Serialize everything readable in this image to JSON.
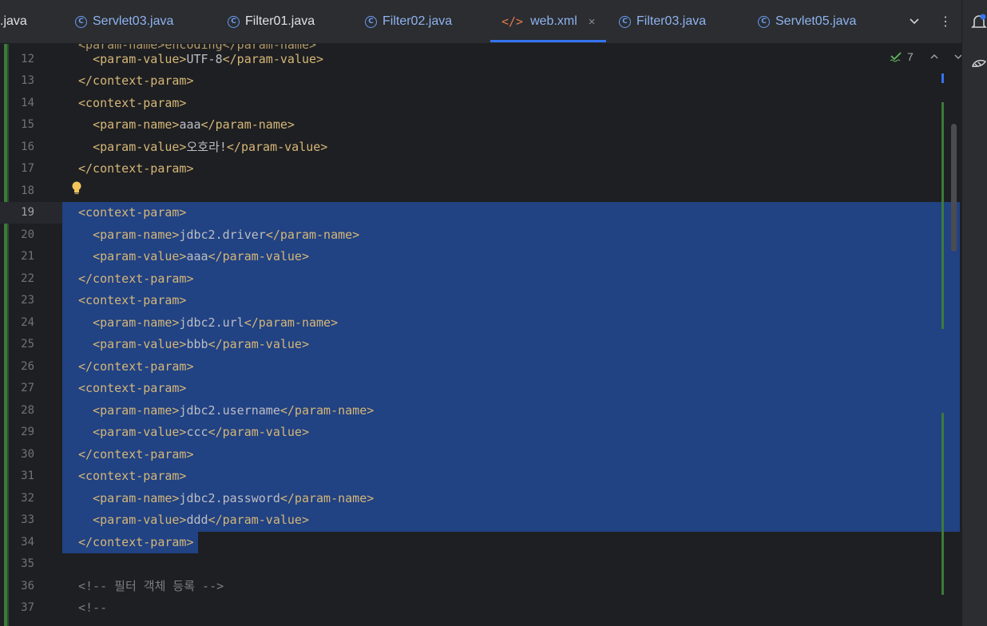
{
  "tabs": [
    {
      "label": ".java",
      "kind": "plain",
      "active": false
    },
    {
      "label": "Servlet03.java",
      "kind": "class",
      "active": false
    },
    {
      "label": "Filter01.java",
      "kind": "class",
      "active": false
    },
    {
      "label": "Filter02.java",
      "kind": "class",
      "active": false
    },
    {
      "label": "web.xml",
      "kind": "xml",
      "active": true
    },
    {
      "label": "Filter03.java",
      "kind": "class",
      "active": false
    },
    {
      "label": "Servlet05.java",
      "kind": "class",
      "active": false
    }
  ],
  "tab_icons": {
    "class": "C",
    "xml": "</>",
    "close": "×",
    "more_tabs": "⌄",
    "menu": "⋮"
  },
  "inspection": {
    "count": "7"
  },
  "current_line": 19,
  "top_fragment": "<param-name>encoding</param-name>",
  "lines": [
    {
      "n": "12",
      "parts": [
        {
          "t": "  "
        },
        {
          "c": "tg",
          "t": "<param-value>"
        },
        {
          "c": "tx",
          "t": "UTF-8"
        },
        {
          "c": "tg",
          "t": "</param-value>"
        }
      ]
    },
    {
      "n": "13",
      "parts": [
        {
          "c": "tg",
          "t": "</context-param>"
        }
      ]
    },
    {
      "n": "14",
      "parts": [
        {
          "c": "tg",
          "t": "<context-param>"
        }
      ]
    },
    {
      "n": "15",
      "parts": [
        {
          "t": "  "
        },
        {
          "c": "tg",
          "t": "<param-name>"
        },
        {
          "c": "tx",
          "t": "aaa"
        },
        {
          "c": "tg",
          "t": "</param-name>"
        }
      ]
    },
    {
      "n": "16",
      "parts": [
        {
          "t": "  "
        },
        {
          "c": "tg",
          "t": "<param-value>"
        },
        {
          "c": "tx",
          "t": "오호라!"
        },
        {
          "c": "tg",
          "t": "</param-value>"
        }
      ]
    },
    {
      "n": "17",
      "parts": [
        {
          "c": "tg",
          "t": "</context-param>"
        }
      ]
    },
    {
      "n": "18",
      "parts": []
    },
    {
      "n": "19",
      "parts": [
        {
          "c": "tg",
          "t": "<context-param>"
        }
      ]
    },
    {
      "n": "20",
      "parts": [
        {
          "t": "  "
        },
        {
          "c": "tg",
          "t": "<param-name>"
        },
        {
          "c": "tx",
          "t": "jdbc2.driver"
        },
        {
          "c": "tg",
          "t": "</param-name>"
        }
      ]
    },
    {
      "n": "21",
      "parts": [
        {
          "t": "  "
        },
        {
          "c": "tg",
          "t": "<param-value>"
        },
        {
          "c": "tx",
          "t": "aaa"
        },
        {
          "c": "tg",
          "t": "</param-value>"
        }
      ]
    },
    {
      "n": "22",
      "parts": [
        {
          "c": "tg",
          "t": "</context-param>"
        }
      ]
    },
    {
      "n": "23",
      "parts": [
        {
          "c": "tg",
          "t": "<context-param>"
        }
      ]
    },
    {
      "n": "24",
      "parts": [
        {
          "t": "  "
        },
        {
          "c": "tg",
          "t": "<param-name>"
        },
        {
          "c": "tx",
          "t": "jdbc2.url"
        },
        {
          "c": "tg",
          "t": "</param-name>"
        }
      ]
    },
    {
      "n": "25",
      "parts": [
        {
          "t": "  "
        },
        {
          "c": "tg",
          "t": "<param-value>"
        },
        {
          "c": "tx",
          "t": "bbb"
        },
        {
          "c": "tg",
          "t": "</param-value>"
        }
      ]
    },
    {
      "n": "26",
      "parts": [
        {
          "c": "tg",
          "t": "</context-param>"
        }
      ]
    },
    {
      "n": "27",
      "parts": [
        {
          "c": "tg",
          "t": "<context-param>"
        }
      ]
    },
    {
      "n": "28",
      "parts": [
        {
          "t": "  "
        },
        {
          "c": "tg",
          "t": "<param-name>"
        },
        {
          "c": "tx",
          "t": "jdbc2.username"
        },
        {
          "c": "tg",
          "t": "</param-name>"
        }
      ]
    },
    {
      "n": "29",
      "parts": [
        {
          "t": "  "
        },
        {
          "c": "tg",
          "t": "<param-value>"
        },
        {
          "c": "tx",
          "t": "ccc"
        },
        {
          "c": "tg",
          "t": "</param-value>"
        }
      ]
    },
    {
      "n": "30",
      "parts": [
        {
          "c": "tg",
          "t": "</context-param>"
        }
      ]
    },
    {
      "n": "31",
      "parts": [
        {
          "c": "tg",
          "t": "<context-param>"
        }
      ]
    },
    {
      "n": "32",
      "parts": [
        {
          "t": "  "
        },
        {
          "c": "tg",
          "t": "<param-name>"
        },
        {
          "c": "tx",
          "t": "jdbc2.password"
        },
        {
          "c": "tg",
          "t": "</param-name>"
        }
      ]
    },
    {
      "n": "33",
      "parts": [
        {
          "t": "  "
        },
        {
          "c": "tg",
          "t": "<param-value>"
        },
        {
          "c": "tx",
          "t": "ddd"
        },
        {
          "c": "tg",
          "t": "</param-value>"
        }
      ]
    },
    {
      "n": "34",
      "parts": [
        {
          "c": "tg",
          "t": "</context-param>"
        }
      ]
    },
    {
      "n": "35",
      "parts": []
    },
    {
      "n": "36",
      "parts": [
        {
          "c": "cm",
          "t": "<!-- 필터 객체 등록 -->"
        }
      ]
    },
    {
      "n": "37",
      "parts": [
        {
          "c": "cm",
          "t": "<!--"
        }
      ]
    }
  ],
  "colors": {
    "tag": "#d5b778",
    "text": "#bcbec4",
    "comment": "#7a7e85",
    "selection": "#214283",
    "accent": "#3574f0"
  }
}
